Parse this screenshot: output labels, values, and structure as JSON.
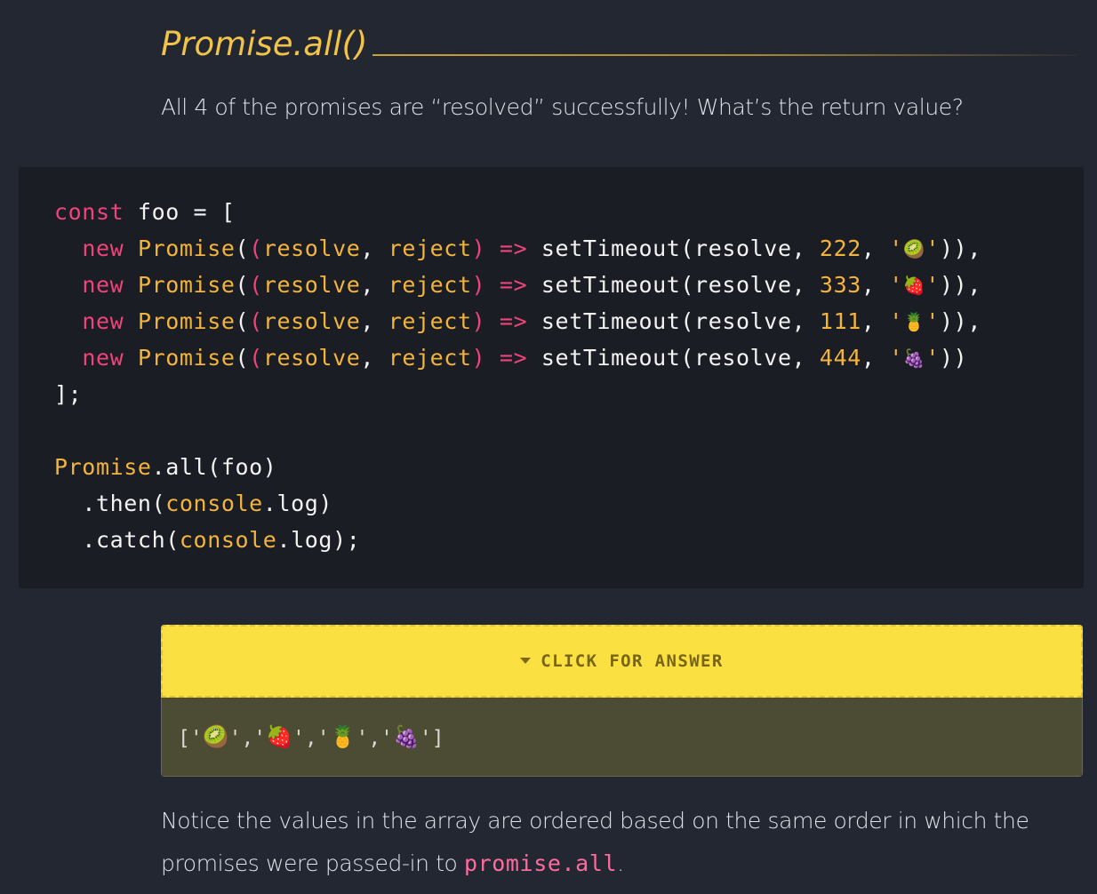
{
  "heading": {
    "title": "Promise.all()"
  },
  "intro": {
    "text": "All 4 of the promises are “resolved” successfully! What’s the return value?"
  },
  "code": {
    "kw_const": "const",
    "var_foo": "foo",
    "op_assign": " = [",
    "kw_new": "new",
    "cls_promise": "Promise",
    "open_paren": "(",
    "param_open": "(",
    "param_resolve": "resolve",
    "param_comma": ", ",
    "param_reject": "reject",
    "param_close": ")",
    "arrow": "=>",
    "fn_settimeout": "setTimeout(resolve, ",
    "line_comma": ", ",
    "quote": "'",
    "entries": [
      {
        "delay": "222",
        "emoji": "🥝",
        "tail": ")),"
      },
      {
        "delay": "333",
        "emoji": "🍓",
        "tail": ")),"
      },
      {
        "delay": "111",
        "emoji": "🍍",
        "tail": ")),"
      },
      {
        "delay": "444",
        "emoji": "🍇",
        "tail": "))"
      }
    ],
    "array_close": "];",
    "promise_all": "Promise",
    "all_call": ".all(foo)",
    "then_method": ".then",
    "catch_method": ".catch",
    "console_obj": "console",
    "log_prop": ".log",
    "then_close": ")",
    "catch_close": ");",
    "paren_open_plain": "("
  },
  "answer": {
    "toggle_label": "CLICK FOR ANSWER",
    "value_open": "['",
    "value_sep": "','",
    "value_close": "']",
    "emojis": [
      "🥝",
      "🍓",
      "🍍",
      "🍇"
    ]
  },
  "notice": {
    "text_before": "Notice the values in the array are ordered based on the same order in which the promises were passed-in to ",
    "code": "promise.all",
    "text_after": "."
  },
  "colors": {
    "background": "#222731",
    "code_background": "#1a1d24",
    "heading": "#f1c34b",
    "keyword": "#f0437a",
    "identifier_yellow": "#f3b43d",
    "answer_toggle": "#fbe041",
    "answer_body": "#4c4b33",
    "inline_code": "#ff6b9e"
  }
}
